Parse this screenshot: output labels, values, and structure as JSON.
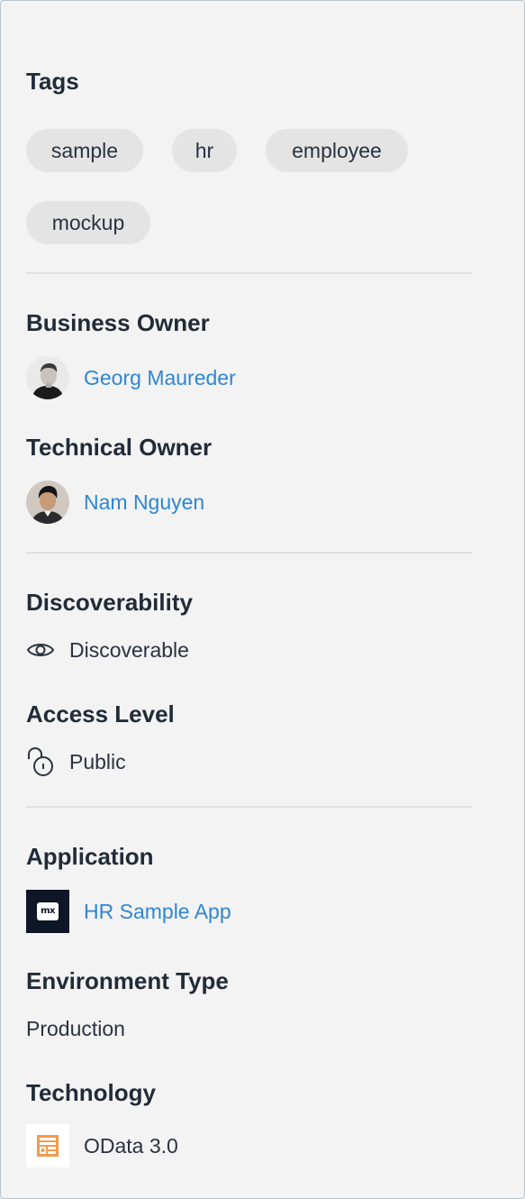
{
  "tags": {
    "heading": "Tags",
    "items": [
      "sample",
      "hr",
      "employee",
      "mockup"
    ]
  },
  "business_owner": {
    "heading": "Business Owner",
    "name": "Georg Maureder"
  },
  "technical_owner": {
    "heading": "Technical Owner",
    "name": "Nam Nguyen"
  },
  "discoverability": {
    "heading": "Discoverability",
    "value": "Discoverable",
    "icon": "eye-icon"
  },
  "access_level": {
    "heading": "Access Level",
    "value": "Public",
    "icon": "unlocked-padlock-icon"
  },
  "application": {
    "heading": "Application",
    "name": "HR Sample App",
    "logo_text": "mx"
  },
  "environment_type": {
    "heading": "Environment Type",
    "value": "Production"
  },
  "technology": {
    "heading": "Technology",
    "value": "OData 3.0",
    "icon": "odata-icon"
  },
  "colors": {
    "link": "#2f86d4",
    "heading": "#222b38",
    "tag_bg": "#e4e4e5",
    "app_tile": "#0e1627",
    "odata_orange": "#f39a4c"
  }
}
